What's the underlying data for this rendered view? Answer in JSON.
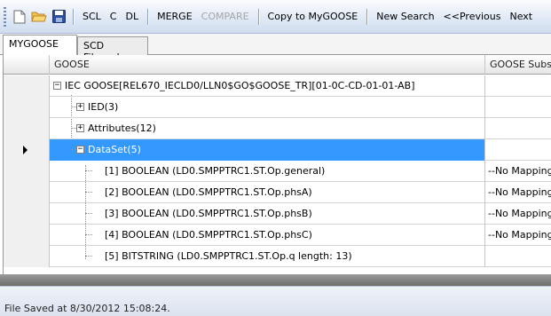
{
  "toolbar": {
    "icons": [
      "new-file-icon",
      "open-folder-icon",
      "save-icon"
    ],
    "buttons": [
      {
        "label": "SCL",
        "disabled": false
      },
      {
        "label": "C",
        "disabled": false
      },
      {
        "label": "DL",
        "disabled": false
      },
      {
        "label": "MERGE",
        "disabled": false
      },
      {
        "label": "COMPARE",
        "disabled": true
      },
      {
        "label": "Copy to MyGOOSE",
        "disabled": false
      },
      {
        "label": "New Search",
        "disabled": false
      },
      {
        "label": "<<Previous",
        "disabled": false
      },
      {
        "label": "Next",
        "disabled": false
      }
    ]
  },
  "tabs": [
    {
      "label": "MYGOOSE",
      "active": true
    },
    {
      "label": "SCD File.scd",
      "active": false
    }
  ],
  "grid": {
    "columns": [
      "GOOSE",
      "GOOSE Subs"
    ],
    "rows": [
      {
        "text": "IEC GOOSE[REL670_IECLD0/LLN0$GO$GOOSE_TR][01-0C-CD-01-01-AB]",
        "toggle": "−",
        "sub": ""
      },
      {
        "text": "IED(3)",
        "toggle": "+",
        "sub": ""
      },
      {
        "text": "Attributes(12)",
        "toggle": "+",
        "sub": ""
      },
      {
        "text": "DataSet(5)",
        "toggle": "−",
        "sub": ""
      },
      {
        "text": "[1] BOOLEAN   (LD0.SMPPTRC1.ST.Op.general)",
        "toggle": "",
        "sub": "--No Mapping"
      },
      {
        "text": "[2] BOOLEAN   (LD0.SMPPTRC1.ST.Op.phsA)",
        "toggle": "",
        "sub": "--No Mapping"
      },
      {
        "text": "[3] BOOLEAN   (LD0.SMPPTRC1.ST.Op.phsB)",
        "toggle": "",
        "sub": "--No Mapping"
      },
      {
        "text": "[4] BOOLEAN   (LD0.SMPPTRC1.ST.Op.phsC)",
        "toggle": "",
        "sub": "--No Mapping"
      },
      {
        "text": "[5] BITSTRING   (LD0.SMPPTRC1.ST.Op.q length: 13)",
        "toggle": "",
        "sub": ""
      }
    ]
  },
  "status": {
    "text": "File Saved at 8/30/2012 15:08:24."
  },
  "colors": {
    "selection": "#3399ff",
    "toolbar_bg": "#dfe8f5",
    "disabled_text": "#a6a6a6"
  }
}
